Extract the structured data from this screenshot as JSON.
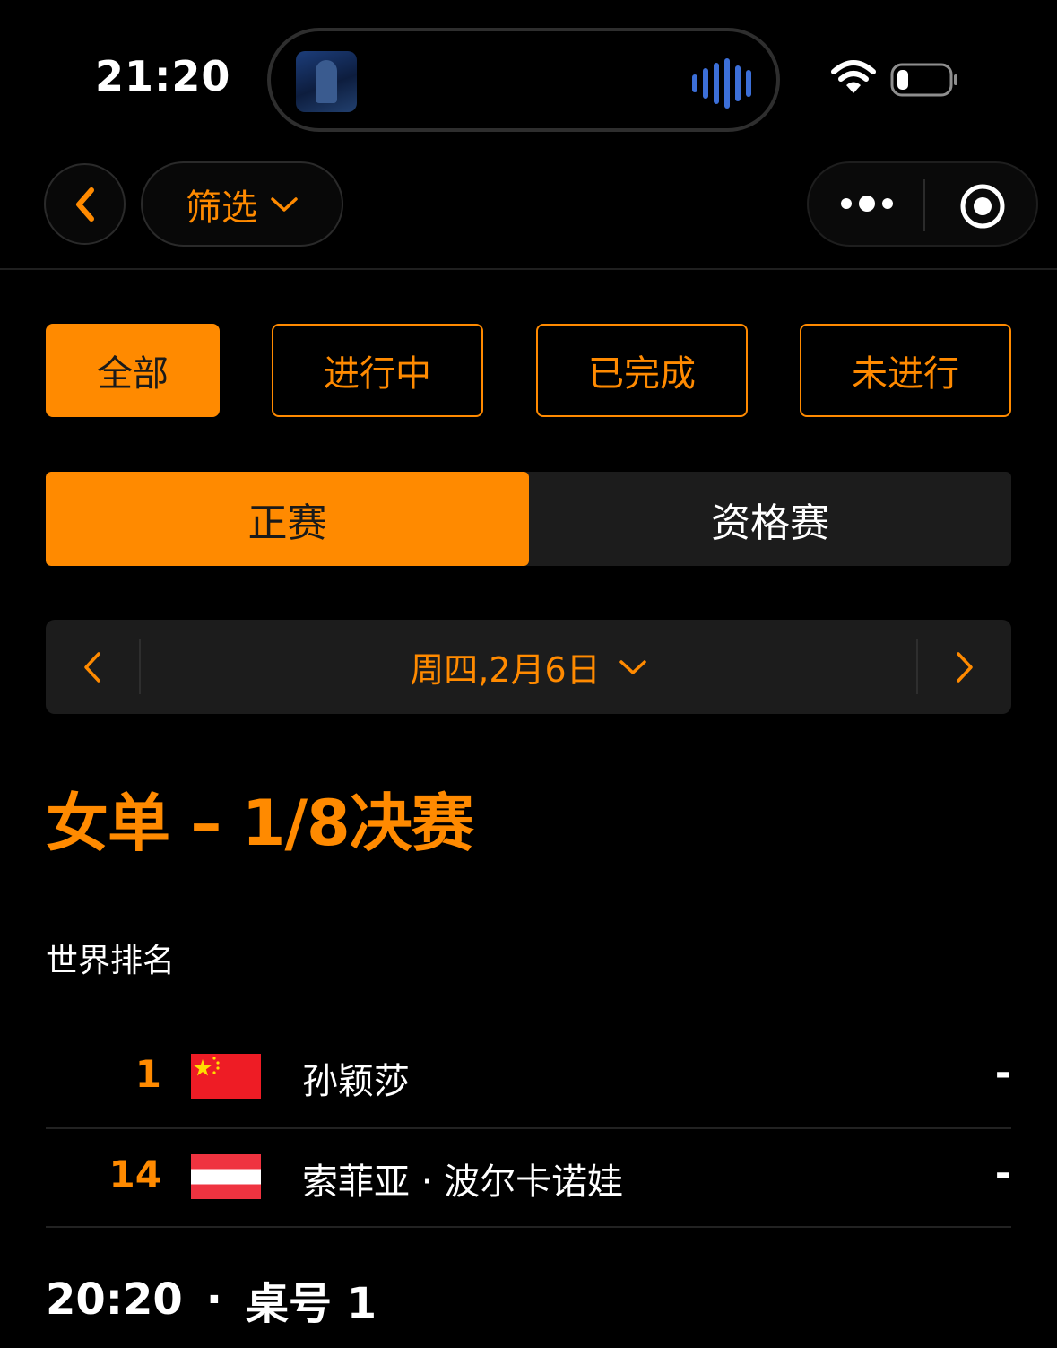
{
  "status_bar": {
    "time": "21:20"
  },
  "nav": {
    "filter_label": "筛选"
  },
  "filters": [
    {
      "label": "全部",
      "active": true
    },
    {
      "label": "进行中",
      "active": false
    },
    {
      "label": "已完成",
      "active": false
    },
    {
      "label": "未进行",
      "active": false
    }
  ],
  "segment": {
    "main_label": "正赛",
    "qualifying_label": "资格赛"
  },
  "date": {
    "label": "周四,2月6日"
  },
  "event": {
    "title": "女单 – 1/8决赛",
    "ranking_heading": "世界排名",
    "players": [
      {
        "rank": "1",
        "flag": "flag-china",
        "name": "孙颖莎",
        "score": "-"
      },
      {
        "rank": "14",
        "flag": "flag-austria",
        "name": "索菲亚 · 波尔卡诺娃",
        "score": "-"
      }
    ],
    "match_time": "20:20",
    "match_separator": "·",
    "table_label": "桌号 1"
  },
  "colors": {
    "accent": "#ff8a00",
    "background": "#000000",
    "panel": "#1c1c1c"
  }
}
